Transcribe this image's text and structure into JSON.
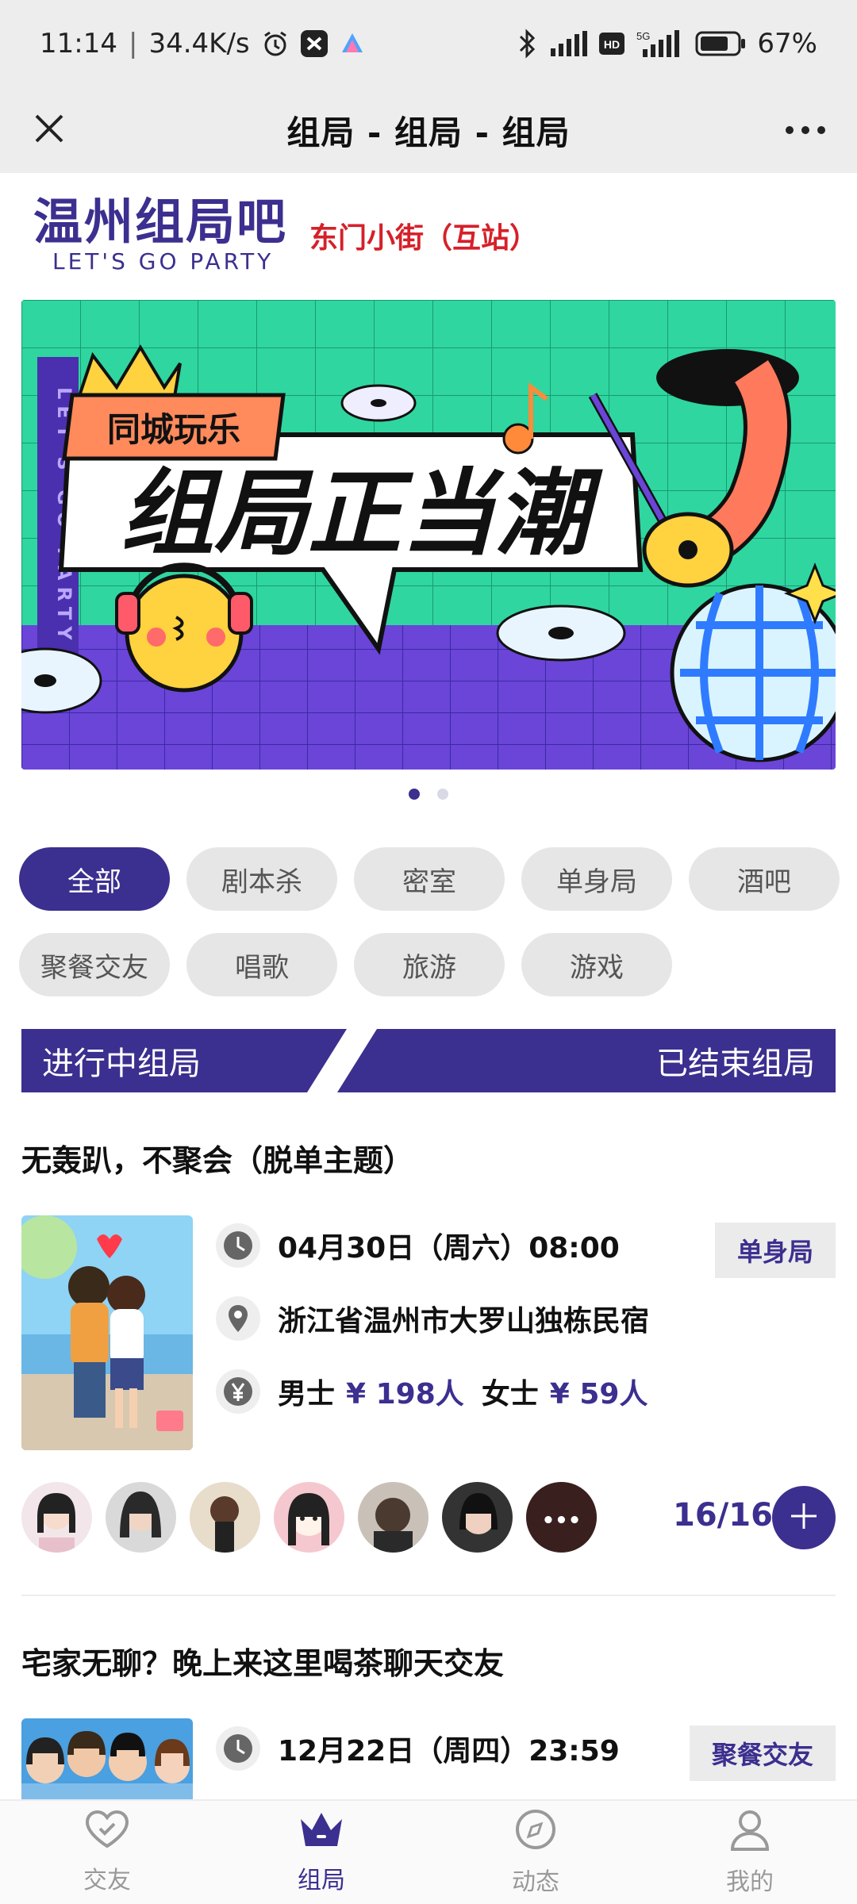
{
  "status_bar": {
    "time": "11:14",
    "speed": "34.4K/s",
    "battery": "67%",
    "icons": [
      "alarm-icon",
      "app-x-icon",
      "app-a-icon",
      "bluetooth-icon",
      "signal-icon",
      "hd-icon",
      "5g-signal-icon",
      "battery-icon"
    ]
  },
  "nav": {
    "title": "组局 - 组局 - 组局",
    "close_icon": "close-icon",
    "more_icon": "more-icon"
  },
  "brand": {
    "name": "温州组局吧",
    "sub": "LET'S GO PARTY",
    "station": "东门小街（互站）"
  },
  "banner": {
    "badge": "同城玩乐",
    "headline": "组局正当潮",
    "side_text": "LET'S GO PARTY",
    "slides_total": 2,
    "slide_active": 1
  },
  "categories": [
    {
      "label": "全部",
      "active": true
    },
    {
      "label": "剧本杀"
    },
    {
      "label": "密室"
    },
    {
      "label": "单身局"
    },
    {
      "label": "酒吧"
    },
    {
      "label": "聚餐交友"
    },
    {
      "label": "唱歌"
    },
    {
      "label": "旅游"
    },
    {
      "label": "游戏"
    }
  ],
  "segment": {
    "ongoing": "进行中组局",
    "ended": "已结束组局"
  },
  "events": [
    {
      "title": "无轰趴，不聚会（脱单主题）",
      "datetime": "04月30日（周六）08:00",
      "location": "浙江省温州市大罗山独栋民宿",
      "price_male_label": "男士",
      "price_male": "¥ 198人",
      "price_female_label": "女士",
      "price_female": "¥ 59人",
      "tag": "单身局",
      "count": "16/16",
      "more_avatars": "•••"
    },
    {
      "title": "宅家无聊？晚上来这里喝茶聊天交友",
      "datetime": "12月22日（周四）23:59",
      "tag": "聚餐交友"
    }
  ],
  "tabbar": [
    {
      "label": "交友",
      "icon": "heart-icon"
    },
    {
      "label": "组局",
      "icon": "crown-icon",
      "active": true
    },
    {
      "label": "动态",
      "icon": "compass-icon"
    },
    {
      "label": "我的",
      "icon": "user-icon"
    }
  ],
  "colors": {
    "brand": "#3b2f8f",
    "station_red": "#d6202a",
    "pill_bg": "#e6e6e6",
    "banner_green": "#2fd6a0",
    "banner_purple": "#6a45d8"
  }
}
